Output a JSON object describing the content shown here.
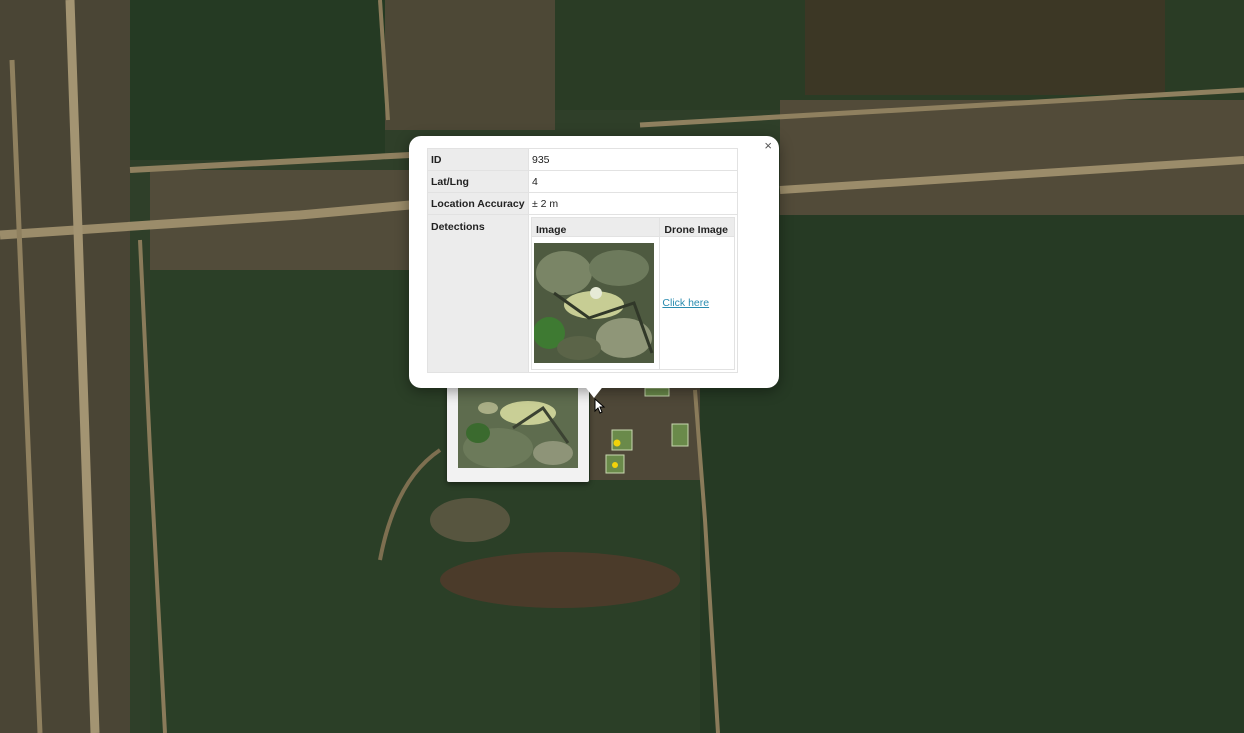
{
  "popup": {
    "close_label": "×",
    "rows": {
      "id": {
        "label": "ID",
        "value": "935"
      },
      "latlng": {
        "label": "Lat/Lng",
        "value": "4"
      },
      "accuracy": {
        "label": "Location Accuracy",
        "value": "± 2 m"
      },
      "detections": {
        "label": "Detections"
      }
    },
    "detections": {
      "columns": {
        "image": "Image",
        "drone": "Drone Image"
      },
      "link_text": "Click here"
    }
  },
  "icons": [
    "close-icon",
    "cursor-icon",
    "detection-marker-icon"
  ],
  "colors": {
    "link": "#2a8cb0",
    "header_bg": "#ececec",
    "marker": "#f2d20a"
  }
}
